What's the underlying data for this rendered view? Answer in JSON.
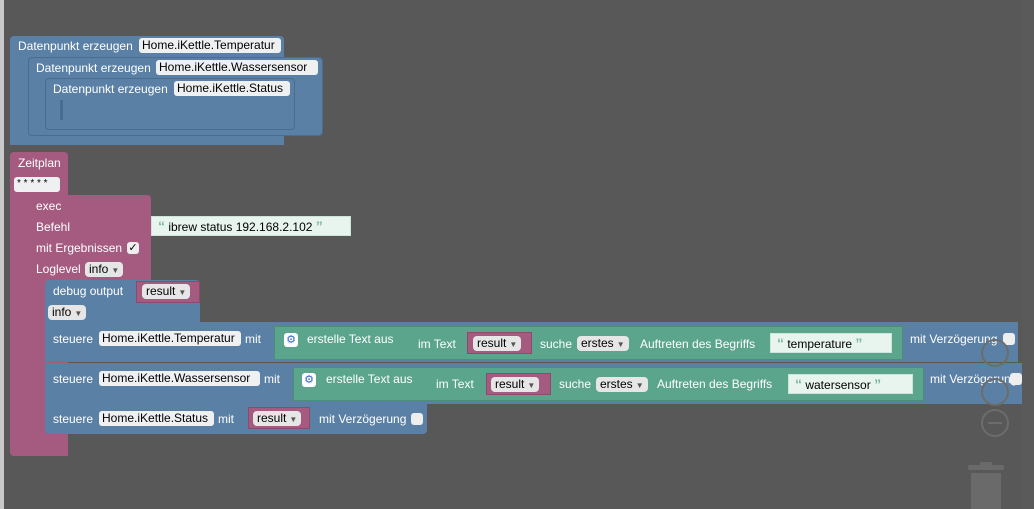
{
  "dp": [
    {
      "label": "Datenpunkt erzeugen",
      "name": "Home.iKettle.Temperatur"
    },
    {
      "label": "Datenpunkt erzeugen",
      "name": "Home.iKettle.Wassersensor"
    },
    {
      "label": "Datenpunkt erzeugen",
      "name": "Home.iKettle.Status"
    }
  ],
  "schedule": {
    "label": "Zeitplan",
    "cron": "* * * * *"
  },
  "exec": {
    "label": "exec",
    "befehl_label": "Befehl",
    "befehl_value": "ibrew status 192.168.2.102",
    "results_label": "mit Ergebnissen",
    "results_checked": "✓",
    "loglevel_label": "Loglevel",
    "loglevel_value": "info"
  },
  "debug": {
    "label": "debug output",
    "var": "result",
    "level": "info"
  },
  "controls": [
    {
      "label": "steuere",
      "target": "Home.iKettle.Temperatur",
      "with": "mit",
      "text_label": "erstelle Text aus",
      "in_text": "im Text",
      "var": "result",
      "search": "suche",
      "mode": "erstes",
      "occ": "Auftreten des Begriffs",
      "term": "temperature",
      "delay": "mit Verzögerung"
    },
    {
      "label": "steuere",
      "target": "Home.iKettle.Wassersensor",
      "with": "mit",
      "text_label": "erstelle Text aus",
      "in_text": "im Text",
      "var": "result",
      "search": "suche",
      "mode": "erstes",
      "occ": "Auftreten des Begriffs",
      "term": "watersensor",
      "delay": "mit Verzögerung"
    },
    {
      "label": "steuere",
      "target": "Home.iKettle.Status",
      "with": "mit",
      "var": "result",
      "delay": "mit Verzögerung"
    }
  ],
  "icons": [
    "gear-icon",
    "dropdown-arrow-icon",
    "quote-icon",
    "zoom-out-icon",
    "trash-icon",
    "checkbox-icon"
  ],
  "colors": {
    "workspace": "#585858",
    "data_block": "#5b80a5",
    "schedule_block": "#a55b80",
    "text_block": "#5ba58c"
  }
}
